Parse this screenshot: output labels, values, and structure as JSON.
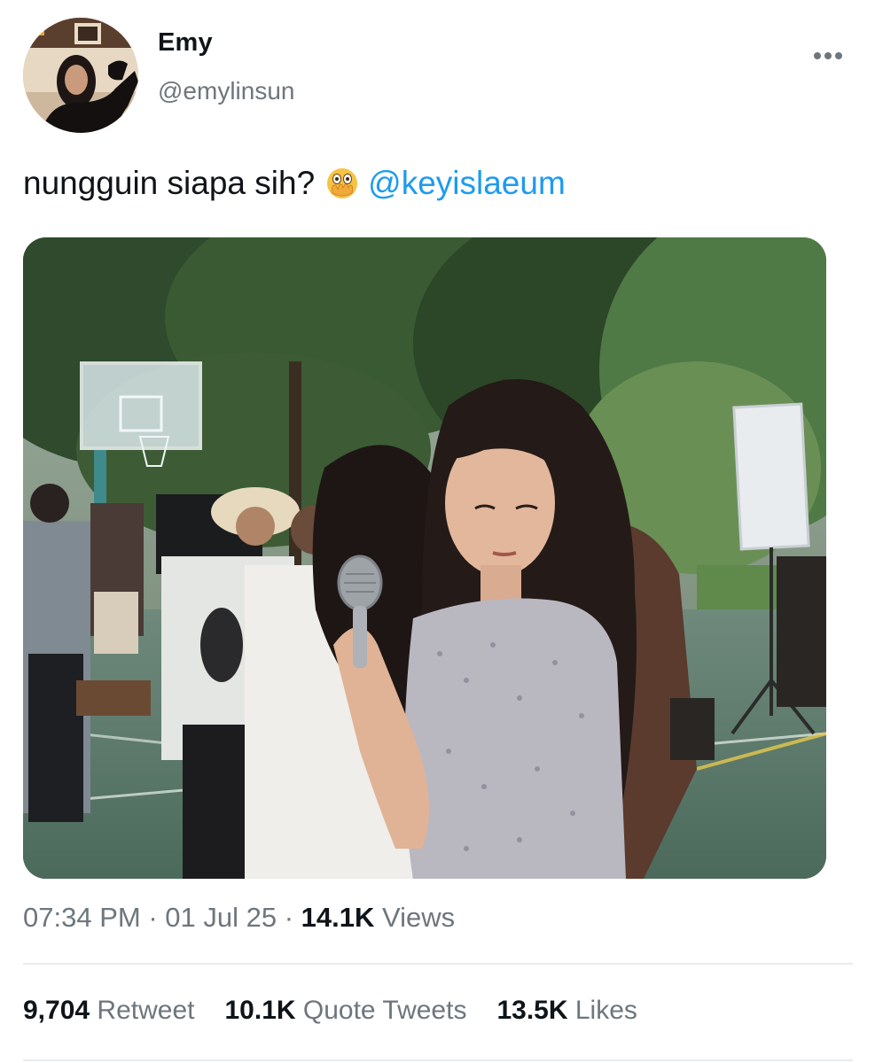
{
  "tweet": {
    "author": {
      "display_name": "Emy",
      "handle": "@emylinsun",
      "avatar": "profile-photo"
    },
    "text": "nungguin siapa sih?",
    "emoji": "face-with-open-eyes-and-hand-over-mouth",
    "mention": "@keyislaeum",
    "media": "photo-girl-holding-handheld-fan-on-film-set",
    "time": "07:34 PM",
    "date": "01 Jul 25",
    "views_count": "14.1K",
    "views_label": "Views"
  },
  "stats": {
    "retweets": {
      "count": "9,704",
      "label": "Retweet"
    },
    "quotes": {
      "count": "10.1K",
      "label": "Quote Tweets"
    },
    "likes": {
      "count": "13.5K",
      "label": "Likes"
    }
  },
  "icons": {
    "more": "more-horizontal-icon"
  },
  "colors": {
    "accent": "#1d9bf0",
    "secondary_text": "#6e767d",
    "primary_text": "#0f1419",
    "divider": "#e6ecf0"
  }
}
